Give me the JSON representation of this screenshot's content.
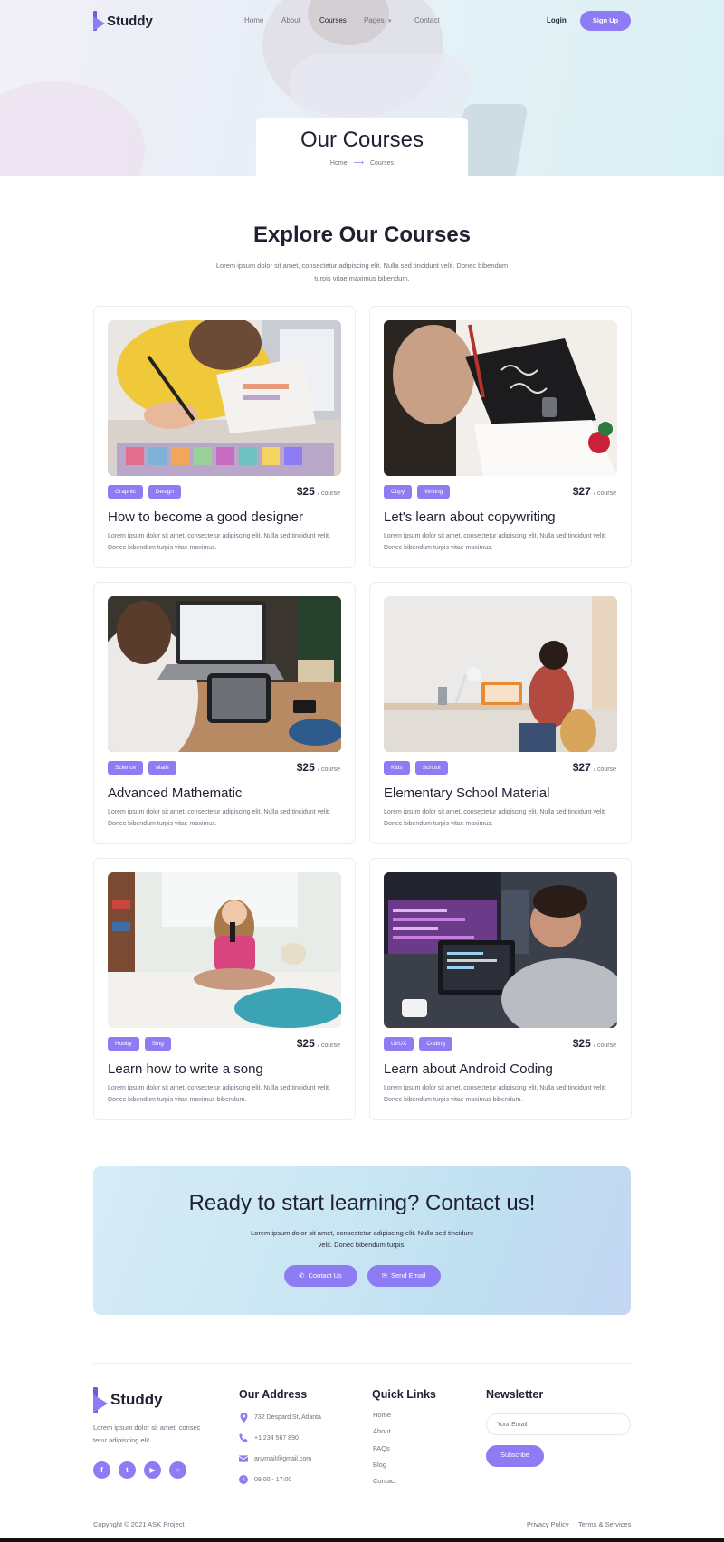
{
  "brand": {
    "name": "Studdy",
    "accent": "#8e7cf4",
    "dark": "#1f2133"
  },
  "nav": {
    "links": [
      "Home",
      "About",
      "Courses",
      "Pages",
      "Contact"
    ],
    "active": "Courses",
    "login": "Login",
    "signup": "Sign Up"
  },
  "hero": {
    "title": "Our Courses",
    "breadcrumb": {
      "home": "Home",
      "current": "Courses"
    }
  },
  "section": {
    "title": "Explore Our Courses",
    "subtitle": "Lorem ipsum dolor sit amet, consectetur adipiscing elit. Nulla sed tincidunt velit. Donec bibendum turpis vitae maximus bibendum."
  },
  "courses": [
    {
      "tags": [
        "Graphic",
        "Design"
      ],
      "price": "$25",
      "unit": "/ course",
      "title": "How to become a good designer",
      "desc": "Lorem ipsum dolor sit amet, consectetur adipiscing elit. Nulla sed tincidunt velit. Donec bibendum turpis vitae maximus."
    },
    {
      "tags": [
        "Copy",
        "Writing"
      ],
      "price": "$27",
      "unit": "/ course",
      "title": "Let's learn about copywriting",
      "desc": "Lorem ipsum dolor sit amet, consectetur adipiscing elit. Nulla sed tincidunt velit. Donec bibendum turpis vitae maximus."
    },
    {
      "tags": [
        "Science",
        "Math"
      ],
      "price": "$25",
      "unit": "/ course",
      "title": "Advanced Mathematic",
      "desc": "Lorem ipsum dolor sit amet, consectetur adipiscing elit. Nulla sed tincidunt velit. Donec bibendum turpis vitae maximus."
    },
    {
      "tags": [
        "Kids",
        "School"
      ],
      "price": "$27",
      "unit": "/ course",
      "title": "Elementary School Material",
      "desc": "Lorem ipsum dolor sit amet, consectetur adipiscing elit. Nulla sed tincidunt velit. Donec bibendum turpis vitae maximus."
    },
    {
      "tags": [
        "Hobby",
        "Sing"
      ],
      "price": "$25",
      "unit": "/ course",
      "title": "Learn how to write a song",
      "desc": "Lorem ipsum dolor sit amet, consectetur adipiscing elit. Nulla sed tincidunt velit. Donec bibendum turpis vitae maximus bibendum."
    },
    {
      "tags": [
        "UI/UX",
        "Coding"
      ],
      "price": "$25",
      "unit": "/ course",
      "title": "Learn about Android Coding",
      "desc": "Lorem ipsum dolor sit amet, consectetur adipiscing elit. Nulla sed tincidunt velit. Donec bibendum turpis vitae maximus bibendum."
    }
  ],
  "cta": {
    "title": "Ready to start learning? Contact us!",
    "text": "Lorem ipsum dolor sit amet, consectetur adipiscing elit. Nulla sed tincidunt velit. Donec bibendum turpis.",
    "contact_label": "Contact Us",
    "email_label": "Send Email"
  },
  "footer": {
    "about": "Lorem ipsum dolor sit amet, consec tetur adipiscing elit.",
    "socials": [
      "facebook-icon",
      "twitter-icon",
      "youtube-icon",
      "instagram-icon"
    ],
    "address_title": "Our Address",
    "address": [
      "732 Despard St, Atlanta",
      "+1 234 567 890",
      "anymail@gmail.com",
      "09:00 - 17:00"
    ],
    "links_title": "Quick Links",
    "links": [
      "Home",
      "About",
      "FAQs",
      "Blog",
      "Contact"
    ],
    "newsletter_title": "Newsletter",
    "email_placeholder": "Your Email",
    "subscribe": "Subscribe",
    "copyright": "Copyright © 2021 ASK Project",
    "privacy": "Privacy Policy",
    "terms": "Terms & Services"
  }
}
